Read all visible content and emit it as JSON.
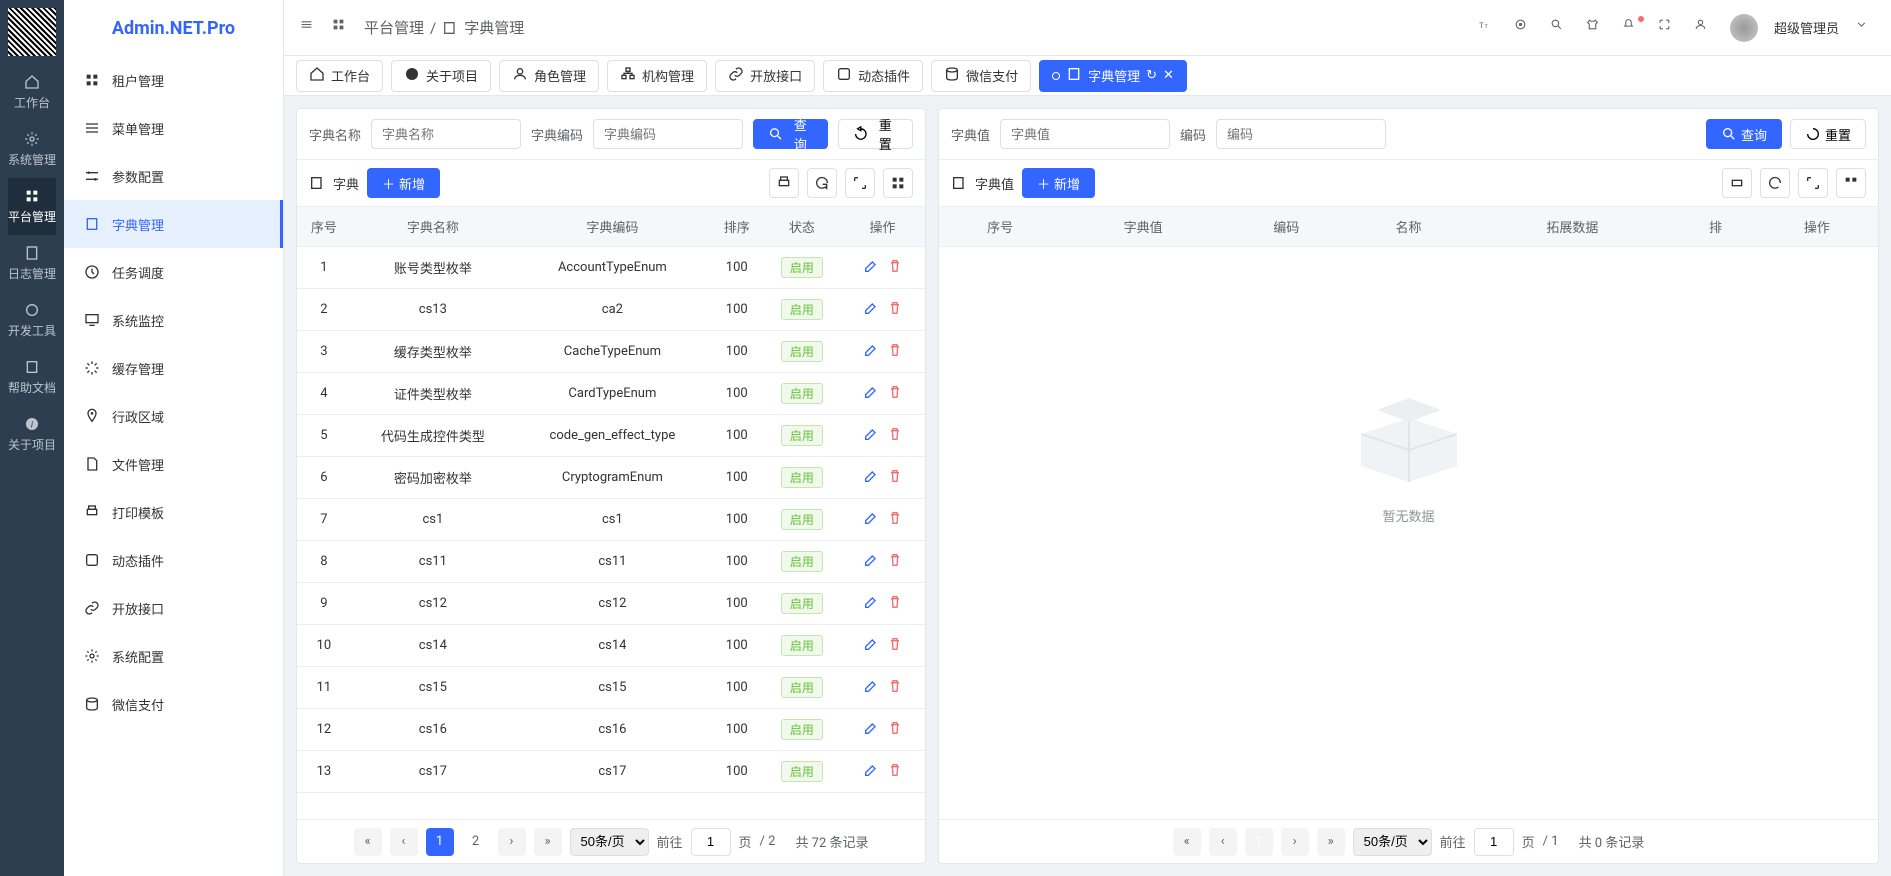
{
  "brand": "Admin.NET.Pro",
  "narrow_nav": [
    {
      "label": "工作台",
      "icon": "home"
    },
    {
      "label": "系统管理",
      "icon": "gear"
    },
    {
      "label": "平台管理",
      "icon": "grid",
      "active": true
    },
    {
      "label": "日志管理",
      "icon": "doc"
    },
    {
      "label": "开发工具",
      "icon": "wrench"
    },
    {
      "label": "帮助文档",
      "icon": "book"
    },
    {
      "label": "关于项目",
      "icon": "info"
    }
  ],
  "menu": [
    {
      "label": "租户管理",
      "icon": "grid"
    },
    {
      "label": "菜单管理",
      "icon": "menu"
    },
    {
      "label": "参数配置",
      "icon": "sliders"
    },
    {
      "label": "字典管理",
      "icon": "book",
      "active": true
    },
    {
      "label": "任务调度",
      "icon": "clock"
    },
    {
      "label": "系统监控",
      "icon": "monitor"
    },
    {
      "label": "缓存管理",
      "icon": "spinner"
    },
    {
      "label": "行政区域",
      "icon": "pin"
    },
    {
      "label": "文件管理",
      "icon": "file"
    },
    {
      "label": "打印模板",
      "icon": "print"
    },
    {
      "label": "动态插件",
      "icon": "plugin"
    },
    {
      "label": "开放接口",
      "icon": "link"
    },
    {
      "label": "系统配置",
      "icon": "gear"
    },
    {
      "label": "微信支付",
      "icon": "db"
    }
  ],
  "breadcrumb": {
    "root": "平台管理",
    "sep": "/",
    "page": "字典管理"
  },
  "user": "超级管理员",
  "tabs": [
    {
      "label": "工作台",
      "icon": "home"
    },
    {
      "label": "关于项目",
      "icon": "info"
    },
    {
      "label": "角色管理",
      "icon": "users"
    },
    {
      "label": "机构管理",
      "icon": "org"
    },
    {
      "label": "开放接口",
      "icon": "link"
    },
    {
      "label": "动态插件",
      "icon": "plugin"
    },
    {
      "label": "微信支付",
      "icon": "db"
    },
    {
      "label": "字典管理",
      "icon": "book",
      "active": true,
      "refresh": true,
      "close": true
    }
  ],
  "left_panel": {
    "search": {
      "name_label": "字典名称",
      "name_ph": "字典名称",
      "code_label": "字典编码",
      "code_ph": "字典编码",
      "query": "查询",
      "reset": "重置"
    },
    "toolbar": {
      "title": "字典",
      "add": "新增"
    },
    "columns": [
      "序号",
      "字典名称",
      "字典编码",
      "排序",
      "状态",
      "操作"
    ],
    "status_label": "启用",
    "rows": [
      {
        "n": 1,
        "name": "账号类型枚举",
        "code": "AccountTypeEnum",
        "sort": 100
      },
      {
        "n": 2,
        "name": "cs13",
        "code": "ca2",
        "sort": 100
      },
      {
        "n": 3,
        "name": "缓存类型枚举",
        "code": "CacheTypeEnum",
        "sort": 100
      },
      {
        "n": 4,
        "name": "证件类型枚举",
        "code": "CardTypeEnum",
        "sort": 100
      },
      {
        "n": 5,
        "name": "代码生成控件类型",
        "code": "code_gen_effect_type",
        "sort": 100
      },
      {
        "n": 6,
        "name": "密码加密枚举",
        "code": "CryptogramEnum",
        "sort": 100
      },
      {
        "n": 7,
        "name": "cs1",
        "code": "cs1",
        "sort": 100
      },
      {
        "n": 8,
        "name": "cs11",
        "code": "cs11",
        "sort": 100
      },
      {
        "n": 9,
        "name": "cs12",
        "code": "cs12",
        "sort": 100
      },
      {
        "n": 10,
        "name": "cs14",
        "code": "cs14",
        "sort": 100
      },
      {
        "n": 11,
        "name": "cs15",
        "code": "cs15",
        "sort": 100
      },
      {
        "n": 12,
        "name": "cs16",
        "code": "cs16",
        "sort": 100
      },
      {
        "n": 13,
        "name": "cs17",
        "code": "cs17",
        "sort": 100
      }
    ],
    "pager": {
      "pages": [
        "1",
        "2"
      ],
      "size": "50条/页",
      "goto": "前往",
      "page_suffix": "页",
      "total_pages": "/ 2",
      "summary": "共 72 条记录",
      "cur": "1"
    }
  },
  "right_panel": {
    "search": {
      "val_label": "字典值",
      "val_ph": "字典值",
      "code_label": "编码",
      "code_ph": "编码",
      "query": "查询",
      "reset": "重置"
    },
    "toolbar": {
      "title": "字典值",
      "add": "新增"
    },
    "columns": [
      "序号",
      "字典值",
      "编码",
      "名称",
      "拓展数据",
      "排",
      "操作"
    ],
    "empty": "暂无数据",
    "pager": {
      "size": "50条/页",
      "goto": "前往",
      "page_suffix": "页",
      "total_pages": "/ 1",
      "summary": "共 0 条记录",
      "cur": "1"
    }
  }
}
